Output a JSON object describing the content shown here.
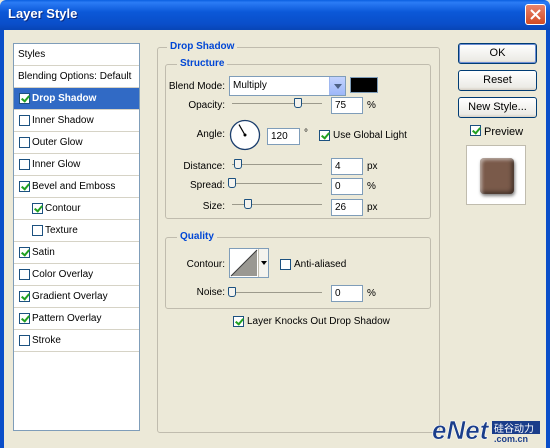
{
  "window": {
    "title": "Layer Style"
  },
  "styles_list": {
    "header": "Styles",
    "blending_options": "Blending Options: Default",
    "items": [
      {
        "label": "Drop Shadow",
        "checked": true,
        "selected": true,
        "indent": false
      },
      {
        "label": "Inner Shadow",
        "checked": false,
        "selected": false,
        "indent": false
      },
      {
        "label": "Outer Glow",
        "checked": false,
        "selected": false,
        "indent": false
      },
      {
        "label": "Inner Glow",
        "checked": false,
        "selected": false,
        "indent": false
      },
      {
        "label": "Bevel and Emboss",
        "checked": true,
        "selected": false,
        "indent": false
      },
      {
        "label": "Contour",
        "checked": true,
        "selected": false,
        "indent": true
      },
      {
        "label": "Texture",
        "checked": false,
        "selected": false,
        "indent": true
      },
      {
        "label": "Satin",
        "checked": true,
        "selected": false,
        "indent": false
      },
      {
        "label": "Color Overlay",
        "checked": false,
        "selected": false,
        "indent": false
      },
      {
        "label": "Gradient Overlay",
        "checked": true,
        "selected": false,
        "indent": false
      },
      {
        "label": "Pattern Overlay",
        "checked": true,
        "selected": false,
        "indent": false
      },
      {
        "label": "Stroke",
        "checked": false,
        "selected": false,
        "indent": false
      }
    ]
  },
  "drop_shadow": {
    "title": "Drop Shadow",
    "structure": {
      "title": "Structure",
      "blend_mode_label": "Blend Mode:",
      "blend_mode_value": "Multiply",
      "shadow_color": "#000000",
      "opacity_label": "Opacity:",
      "opacity_value": "75",
      "opacity_unit": "%",
      "opacity_fraction": 0.75,
      "angle_label": "Angle:",
      "angle_value": "120",
      "angle_unit": "°",
      "use_global_light_label": "Use Global Light",
      "use_global_light": true,
      "distance_label": "Distance:",
      "distance_value": "4",
      "distance_unit": "px",
      "distance_fraction": 0.03,
      "spread_label": "Spread:",
      "spread_value": "0",
      "spread_unit": "%",
      "spread_fraction": 0,
      "size_label": "Size:",
      "size_value": "26",
      "size_unit": "px",
      "size_fraction": 0.15
    },
    "quality": {
      "title": "Quality",
      "contour_label": "Contour:",
      "anti_aliased_label": "Anti-aliased",
      "anti_aliased": false,
      "noise_label": "Noise:",
      "noise_value": "0",
      "noise_unit": "%",
      "noise_fraction": 0
    },
    "layer_knocks_out_label": "Layer Knocks Out Drop Shadow",
    "layer_knocks_out": true
  },
  "buttons": {
    "ok": "OK",
    "cancel": "Reset",
    "new_style": "New Style...",
    "preview_label": "Preview",
    "preview_checked": true
  },
  "colors": {
    "title_bar": "#0a4ec9",
    "selection": "#316ac5",
    "group_label": "#0046d5",
    "preview_swatch": "#7a5a4a"
  },
  "watermark": {
    "text": "eNet",
    "subtext": "硅谷动力 .com.cn"
  }
}
